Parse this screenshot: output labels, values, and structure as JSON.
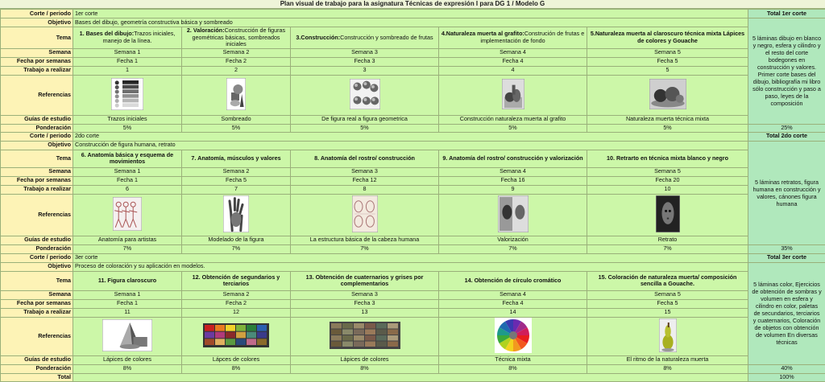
{
  "title": "Plan visual de trabajo para la asignatura Técnicas de expresión I para DG 1 / Modelo G",
  "labels": {
    "corte": "Corte / periodo",
    "objetivo": "Objetivo",
    "tema": "Tema",
    "semana": "Semana",
    "fecha": "Fecha por semanas",
    "trabajo": "Trabajo a realizar",
    "referencias": "Referencias",
    "guias": "Guías de estudio",
    "ponderacion": "Ponderación",
    "total": "Total"
  },
  "grand_total": "100%",
  "cortes": [
    {
      "periodo": "1er corte",
      "objetivo": "Bases del dibujo, geometría constructiva básica y sombreado",
      "total_label": "Total 1er corte",
      "summary": "5 láminas dibujo en blanco y negro, esfera y cilindro y el resto del corte bodegones en construcción y valores. Primer corte bases del dibujo, bibliografía mi libro sólo construcción y paso a paso, leyes de la composición",
      "total_pct": "25%",
      "temas": [
        {
          "bold": "1. Bases del dibujo:",
          "normal": "Trazos iniciales, manejo de la línea.",
          "semana": "Semana 1",
          "fecha": "Fecha 1",
          "trabajo": "1",
          "guia": "Trazos iniciales",
          "pond": "5%",
          "ref": "value-scale-icon"
        },
        {
          "bold": "2. Valoración:",
          "normal": "Construcción de figuras geométricas básicas, sombreados iniciales",
          "semana": "Semana 2",
          "fecha": "Fecha 2",
          "trabajo": "2",
          "guia": "Sombreado",
          "pond": "5%",
          "ref": "geometric-shapes-icon"
        },
        {
          "bold": "3.Construcción:",
          "normal": "Construcción y sombreado de frutas",
          "semana": "Semana 3",
          "fecha": "Fecha 3",
          "trabajo": "3",
          "guia": "De figura real a figura geometrica",
          "pond": "5%",
          "ref": "fruits-icon"
        },
        {
          "bold": "4.Naturaleza muerta al grafito:",
          "normal": "Construción de frutas e implementación de fondo",
          "semana": "Semana 4",
          "fecha": "Fecha 4",
          "trabajo": "4",
          "guia": "Construcción naturaleza muerta al grafito",
          "pond": "5%",
          "ref": "still-life-graphite-icon"
        },
        {
          "bold": "5.Naturaleza muerta al claroscuro técnica mixta Lápices de colores y Gouache",
          "normal": "",
          "semana": "Semana 5",
          "fecha": "Fecha 5",
          "trabajo": "5",
          "guia": "Naturaleza muerta técnica mixta",
          "pond": "5%",
          "ref": "still-life-mixed-icon"
        }
      ]
    },
    {
      "periodo": "2do corte",
      "objetivo": "Construcción de figura humana, retrato",
      "total_label": "Total 2do corte",
      "summary": "5 láminas retratos, figura humana en construcción y valores, cánones figura humana",
      "total_pct": "35%",
      "temas": [
        {
          "bold": "6. Anatomía básica y esquema de movimientos",
          "normal": "",
          "semana": "Semana 1",
          "fecha": "Fecha 1",
          "trabajo": "6",
          "guia": "Anatomía para artistas",
          "pond": "7%",
          "ref": "anatomy-sketch-icon"
        },
        {
          "bold": "7. Anatomía, músculos y valores",
          "normal": "",
          "semana": "Semana  2",
          "fecha": "Fecha 5",
          "trabajo": "7",
          "guia": "Modelado de la figura",
          "pond": "7%",
          "ref": "hand-drawing-icon"
        },
        {
          "bold": "8. Anatomía del rostro/ construcción",
          "normal": "",
          "semana": "Semana 3",
          "fecha": "Fecha 12",
          "trabajo": "8",
          "guia": "La estructura básica de la cabeza humana",
          "pond": "7%",
          "ref": "head-structure-icon"
        },
        {
          "bold": "9. Anatomía del rostro/ construcción y valorización",
          "normal": "",
          "semana": "Semana 4",
          "fecha": "Fecha 16",
          "trabajo": "9",
          "guia": "Valorización",
          "pond": "7%",
          "ref": "face-values-icon"
        },
        {
          "bold": "10. Retrarto en técnica mixta blanco y negro",
          "normal": "",
          "semana": "Semana 5",
          "fecha": "Fecha 20",
          "trabajo": "10",
          "guia": "Retrato",
          "pond": "7%",
          "ref": "portrait-icon"
        }
      ]
    },
    {
      "periodo": "3er corte",
      "objetivo": "Proceso de coloración y su aplicación en modelos.",
      "total_label": "Total 3er corte",
      "summary": "5 láminas color, Ejercicios de obtención de sombras y volumen en esfera y cilindro en color, paletas de secundarios, terciarios y cuaternarios, Coloración de objetos con obtención de volumen En diversas técnicas",
      "total_pct": "40%",
      "temas": [
        {
          "bold": "11. Figura claroscuro",
          "normal": "",
          "semana": "Semana 1",
          "fecha": "Fecha 1",
          "trabajo": "11",
          "guia": "Lápices de colores",
          "pond": "8%",
          "ref": "cone-icon"
        },
        {
          "bold": "12. Obtención de segundarios y terciarios",
          "normal": "",
          "semana": "Semana 2",
          "fecha": "Fecha 2",
          "trabajo": "12",
          "guia": "Lápces de colores",
          "pond": "8%",
          "ref": "color-palette-icon"
        },
        {
          "bold": "13. Obtención de cuaternarios y grises por complementarios",
          "normal": "",
          "semana": "Semana 3",
          "fecha": "Fecha 3",
          "trabajo": "13",
          "guia": "Lápices de colores",
          "pond": "8%",
          "ref": "muted-palette-icon"
        },
        {
          "bold": "14. Obtención de círculo cromático",
          "normal": "",
          "semana": "Semana 4",
          "fecha": "Fecha 4",
          "trabajo": "14",
          "guia": "Técnica mixta",
          "pond": "8%",
          "ref": "color-wheel-icon"
        },
        {
          "bold": "15. Coloración de naturaleza muerta/ composición sencilla a Gouache.",
          "normal": "",
          "semana": "Semana 5",
          "fecha": "Fecha 5",
          "trabajo": "15",
          "guia": "El ritmo de la naturaleza muerta",
          "pond": "8%",
          "ref": "pear-icon"
        }
      ]
    }
  ]
}
